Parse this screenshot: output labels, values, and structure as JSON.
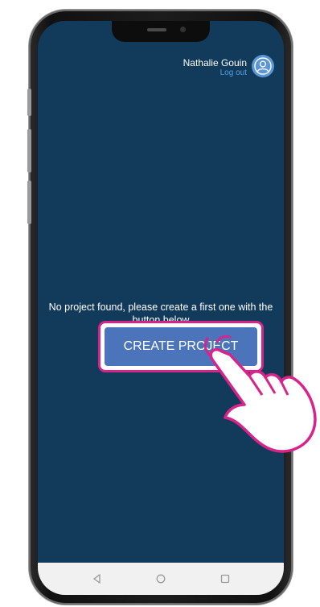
{
  "header": {
    "user_name": "Nathalie Gouin",
    "logout_label": "Log out"
  },
  "empty_state": {
    "message": "No project found, please create a first one with the button below",
    "create_button_label": "CREATE PROJECT"
  },
  "nav_bar": {
    "icons": [
      "back-icon",
      "home-icon",
      "recents-icon"
    ]
  },
  "colors": {
    "screen_background": "#123a5a",
    "button": "#4c74bb",
    "highlight": "#d8238a",
    "link": "#4aa3e8",
    "avatar": "#5b95d6"
  }
}
